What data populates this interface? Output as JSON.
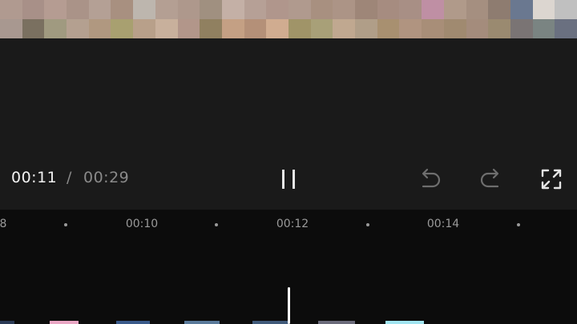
{
  "preview": {
    "mosaic_colors": [
      "#b09a90",
      "#a89088",
      "#b59c92",
      "#aa9388",
      "#b4a095",
      "#a89080",
      "#bdb6ae",
      "#b49f93",
      "#ae988c",
      "#a09080",
      "#c4b0a6",
      "#b6a096",
      "#b0968c",
      "#b09a8e",
      "#a89080",
      "#ac9486",
      "#9e8678",
      "#a68c80",
      "#a88f85",
      "#bf8fa4",
      "#b09a8a",
      "#a58f80",
      "#8e7c70",
      "#6a7890",
      "#dcd6d0",
      "#c0c0c0",
      "#a89890",
      "#7a7060",
      "#a09a80",
      "#b4a090",
      "#b09880",
      "#a8a070",
      "#b8a08a",
      "#c8b09c",
      "#b2968a",
      "#908060",
      "#c4a084",
      "#b49078",
      "#d0ac90",
      "#a09468",
      "#a8a078",
      "#c0a890",
      "#b09e88",
      "#a89070",
      "#b09480",
      "#a88e78",
      "#a08a70",
      "#a48c7c",
      "#9a8a70",
      "#7a7474",
      "#7a8482",
      "#6a7080"
    ]
  },
  "player": {
    "current_time": "00:11",
    "separator": "/",
    "total_time": "00:29"
  },
  "icons": {
    "pause": "pause-icon",
    "undo": "undo-icon",
    "redo": "redo-icon",
    "fullscreen": "fullscreen-icon"
  },
  "timeline": {
    "ruler": [
      {
        "label": "8",
        "kind": "label"
      },
      {
        "label": "",
        "kind": "dot"
      },
      {
        "label": "00:10",
        "kind": "label"
      },
      {
        "label": "",
        "kind": "dot"
      },
      {
        "label": "00:12",
        "kind": "label"
      },
      {
        "label": "",
        "kind": "dot"
      },
      {
        "label": "00:14",
        "kind": "label"
      },
      {
        "label": "",
        "kind": "dot"
      }
    ],
    "clip_colors": [
      "#2a3a55",
      "#e9a6c4",
      "#3a5a8a",
      "#5a7a9a",
      "#405a7a",
      "#6a6a7a",
      "#a0e4f0"
    ]
  },
  "colors": {
    "stage_bg": "#1a1a1a",
    "timeline_bg": "#0c0c0c",
    "playhead": "#ffffff",
    "icon_active": "#e6e6e6",
    "icon_disabled": "#6e6e6e"
  }
}
